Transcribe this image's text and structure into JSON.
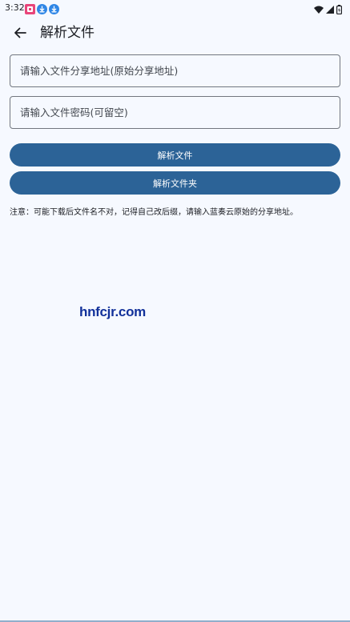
{
  "status_bar": {
    "time": "3:32",
    "notifications": [
      "app-badge-icon",
      "download-icon",
      "download-icon"
    ],
    "indicators": [
      "wifi-icon",
      "signal-icon",
      "battery-icon"
    ]
  },
  "app_bar": {
    "title": "解析文件"
  },
  "form": {
    "url_placeholder": "请输入文件分享地址(原始分享地址)",
    "url_value": "",
    "password_placeholder": "请输入文件密码(可留空)",
    "password_value": ""
  },
  "actions": {
    "parse_file_label": "解析文件",
    "parse_folder_label": "解析文件夹"
  },
  "notice": "注意：可能下载后文件名不对，记得自己改后缀，请输入蓝奏云原始的分享地址。",
  "watermark": "hnfcjr.com",
  "colors": {
    "background": "#f6f9ff",
    "primary": "#2c6397",
    "outline": "#72777f",
    "watermark": "#12319a"
  }
}
